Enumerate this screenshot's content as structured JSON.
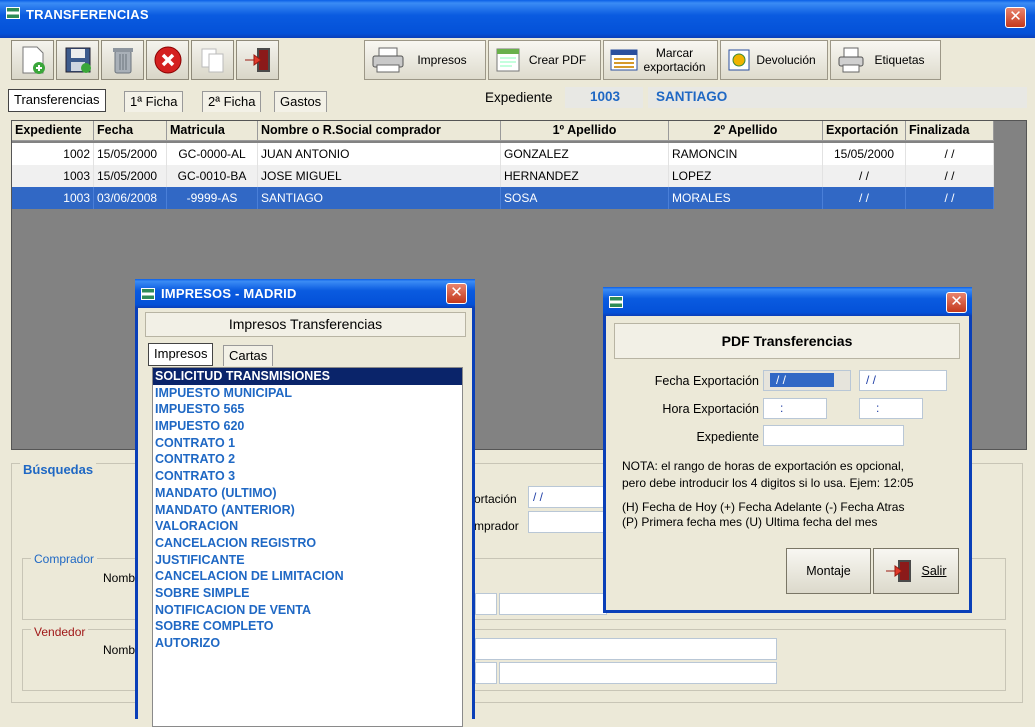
{
  "main": {
    "title": "TRANSFERENCIAS",
    "toolbar": {
      "impresos": "Impresos",
      "crear_pdf": "Crear PDF",
      "marcar_line1": "Marcar",
      "marcar_line2": "exportación",
      "devolucion": "Devolución",
      "etiquetas": "Etiquetas"
    },
    "tabs": [
      "Transferencias",
      "1ª Ficha",
      "2ª Ficha",
      "Gastos"
    ],
    "expediente_label": "Expediente",
    "expediente_value": "1003",
    "expediente_name": "SANTIAGO",
    "grid": {
      "headers": [
        "Expediente",
        "Fecha",
        "Matricula",
        "Nombre o R.Social comprador",
        "1º Apellido",
        "2º Apellido",
        "Exportación",
        "Finalizada"
      ],
      "rows": [
        [
          "1002",
          "15/05/2000",
          "GC-0000-AL",
          "JUAN ANTONIO",
          "GONZALEZ",
          "RAMONCIN",
          "15/05/2000",
          "/ /"
        ],
        [
          "1003",
          "15/05/2000",
          "GC-0010-BA",
          "JOSE MIGUEL",
          "HERNANDEZ",
          "LOPEZ",
          "/ /",
          "/ /"
        ],
        [
          "1003",
          "03/06/2008",
          "-9999-AS",
          "SANTIAGO",
          "SOSA",
          "MORALES",
          "/ /",
          "/ /"
        ]
      ]
    },
    "busquedas": {
      "title": "Búsquedas",
      "exportacion_label": "ortación",
      "exportacion_value": "/ /",
      "comprador_label": "mprador",
      "comprador_group": "Comprador",
      "vendedor_group": "Vendedor",
      "nombre_label": "Nomb"
    }
  },
  "impresos_dialog": {
    "title": "IMPRESOS - MADRID",
    "header": "Impresos Transferencias",
    "tabs": [
      "Impresos",
      "Cartas"
    ],
    "items": [
      "SOLICITUD TRANSMISIONES",
      "IMPUESTO MUNICIPAL",
      "IMPUESTO 565",
      "IMPUESTO 620",
      "CONTRATO 1",
      "CONTRATO 2",
      "CONTRATO 3",
      "MANDATO (ULTIMO)",
      "MANDATO (ANTERIOR)",
      "VALORACION",
      "CANCELACION REGISTRO",
      "JUSTIFICANTE",
      "CANCELACION DE LIMITACION",
      "SOBRE SIMPLE",
      "NOTIFICACION DE VENTA",
      "SOBRE COMPLETO",
      "AUTORIZO"
    ]
  },
  "pdf_dialog": {
    "header": "PDF Transferencias",
    "fecha_label": "Fecha Exportación",
    "fecha_from": "/ /",
    "fecha_to": "/ /",
    "hora_label": "Hora Exportación",
    "hora_from": ":",
    "hora_to": ":",
    "expediente_label": "Expediente",
    "nota_line1": "NOTA: el rango de horas de exportación es opcional,",
    "nota_line2": "pero debe introducir los 4 digitos si lo usa.  Ejem: 12:05",
    "help_line1": "(H) Fecha de Hoy   (+) Fecha Adelante   (-) Fecha Atras",
    "help_line2": "(P) Primera fecha mes   (U) Ultima fecha del mes",
    "montaje": "Montaje",
    "salir": "Salir"
  }
}
